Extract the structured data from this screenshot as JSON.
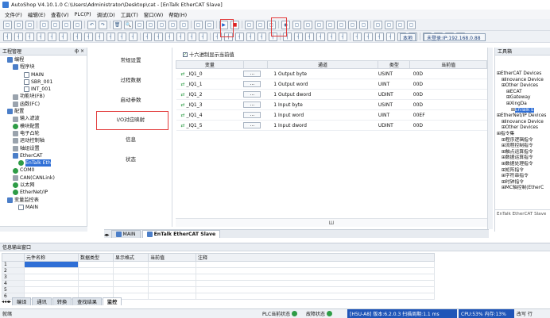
{
  "window": {
    "title": "AutoShop V4.10.1.0  C:\\Users\\Administrator\\Desktop\\cat - [EnTalk EtherCAT Slave]"
  },
  "menu": [
    "文件(F)",
    "编辑(E)",
    "查看(V)",
    "PLC(P)",
    "调试(D)",
    "工具(T)",
    "窗口(W)",
    "帮助(H)"
  ],
  "toolbar": {
    "local_label": "本地",
    "login_label": "未登录:IP:192.168.0.88"
  },
  "project_panel": {
    "title": "工程管理",
    "pin": "ф ×"
  },
  "project_tree": [
    {
      "label": "编程",
      "indent": 1,
      "icon": "folder"
    },
    {
      "label": "程序块",
      "indent": 2,
      "icon": "folder"
    },
    {
      "label": "MAIN",
      "indent": 4,
      "icon": "doc"
    },
    {
      "label": "SBR_001",
      "indent": 4,
      "icon": "doc"
    },
    {
      "label": "INT_001",
      "indent": 4,
      "icon": "doc"
    },
    {
      "label": "功能块(FB)",
      "indent": 2,
      "icon": "grid"
    },
    {
      "label": "函数(FC)",
      "indent": 2,
      "icon": "grid"
    },
    {
      "label": "配置",
      "indent": 1,
      "icon": "folder"
    },
    {
      "label": "输入滤波",
      "indent": 2,
      "icon": "tool"
    },
    {
      "label": "模块配置",
      "indent": 2,
      "icon": "green"
    },
    {
      "label": "电子凸轮",
      "indent": 2,
      "icon": "tool"
    },
    {
      "label": "运动控制轴",
      "indent": 2,
      "icon": "tool"
    },
    {
      "label": "轴组设置",
      "indent": 2,
      "icon": "tool"
    },
    {
      "label": "EtherCAT",
      "indent": 2,
      "icon": "folder"
    },
    {
      "label": "EnTalk Eth",
      "indent": 3,
      "icon": "green",
      "selected": true
    },
    {
      "label": "COM0",
      "indent": 2,
      "icon": "green"
    },
    {
      "label": "CAN(CANLink)",
      "indent": 2,
      "icon": "tool"
    },
    {
      "label": "以太网",
      "indent": 2,
      "icon": "green"
    },
    {
      "label": "EtherNet/IP",
      "indent": 2,
      "icon": "green"
    },
    {
      "label": "变量监控表",
      "indent": 1,
      "icon": "folder"
    },
    {
      "label": "MAIN",
      "indent": 3,
      "icon": "doc"
    }
  ],
  "config_nav": [
    {
      "label": "常规设置"
    },
    {
      "label": "过程数据"
    },
    {
      "label": "启动参数"
    },
    {
      "label": "I/O对应映射",
      "highlighted": true
    },
    {
      "label": "信息"
    },
    {
      "label": "状态"
    }
  ],
  "hex_checkbox": {
    "label": "十六进制显示当前值"
  },
  "io_table": {
    "headers": [
      "变量",
      "",
      "通道",
      "类型",
      "当前值"
    ],
    "rows": [
      {
        "var": "_IQ1_0",
        "channel": "1 Output byte",
        "type": "USINT",
        "value": "00D"
      },
      {
        "var": "_IQ1_1",
        "channel": "1 Output word",
        "type": "UINT",
        "value": "00D"
      },
      {
        "var": "_IQ1_2",
        "channel": "1 Output dword",
        "type": "UDINT",
        "value": "00D"
      },
      {
        "var": "_IQ1_3",
        "channel": "1 Input byte",
        "type": "USINT",
        "value": "00D"
      },
      {
        "var": "_IQ1_4",
        "channel": "1 Input word",
        "type": "UINT",
        "value": "00EF"
      },
      {
        "var": "_IQ1_5",
        "channel": "1 Input dword",
        "type": "UDINT",
        "value": "00D"
      }
    ],
    "dots": "..."
  },
  "editor_tabs": [
    {
      "label": "MAIN",
      "active": false
    },
    {
      "label": "EnTalk EtherCAT Slave",
      "active": true
    }
  ],
  "toolbox": {
    "title": "工具箱",
    "items": [
      {
        "label": "EtherCAT Devices",
        "indent": 0
      },
      {
        "label": "Inovance Device",
        "indent": 1
      },
      {
        "label": "Other Devices",
        "indent": 1
      },
      {
        "label": "ECAT",
        "indent": 2
      },
      {
        "label": "Gateway",
        "indent": 2
      },
      {
        "label": "XingDa",
        "indent": 2
      },
      {
        "label": "EnTalk E",
        "indent": 3,
        "selected": true
      },
      {
        "label": "EtherNet/IP Devices",
        "indent": 0
      },
      {
        "label": "Inovance Device",
        "indent": 1
      },
      {
        "label": "Other Devices",
        "indent": 1
      },
      {
        "label": "指令集",
        "indent": 0
      },
      {
        "label": "程序逻辑指令",
        "indent": 1
      },
      {
        "label": "流程控制指令",
        "indent": 1
      },
      {
        "label": "触点运算指令",
        "indent": 1
      },
      {
        "label": "数据运算指令",
        "indent": 1
      },
      {
        "label": "数据处理指令",
        "indent": 1
      },
      {
        "label": "矩阵指令",
        "indent": 1
      },
      {
        "label": "字符串指令",
        "indent": 1
      },
      {
        "label": "时钟指令",
        "indent": 1
      },
      {
        "label": "MC轴控制(EtherC",
        "indent": 1
      }
    ],
    "footer": "EnTalk EtherCAT Slave"
  },
  "output_panel": {
    "title": "信息输出窗口",
    "headers": [
      "元件名称",
      "数据类型",
      "显示格式",
      "当前值",
      "注释"
    ],
    "row_numbers": [
      "1",
      "2",
      "3",
      "4",
      "5",
      "6",
      "7"
    ],
    "tabs": [
      "编译",
      "通讯",
      "转换",
      "查找结果",
      "监控"
    ]
  },
  "statusbar": {
    "ready": "就绪",
    "plc_state": "PLC当前状态",
    "fault": "故障状态",
    "device": "[H5U-A8] 版本:6.2.0.3 扫描周期:1.1 ms",
    "cpu": "CPU:53%  内存:13%",
    "mode": "改写 行"
  }
}
